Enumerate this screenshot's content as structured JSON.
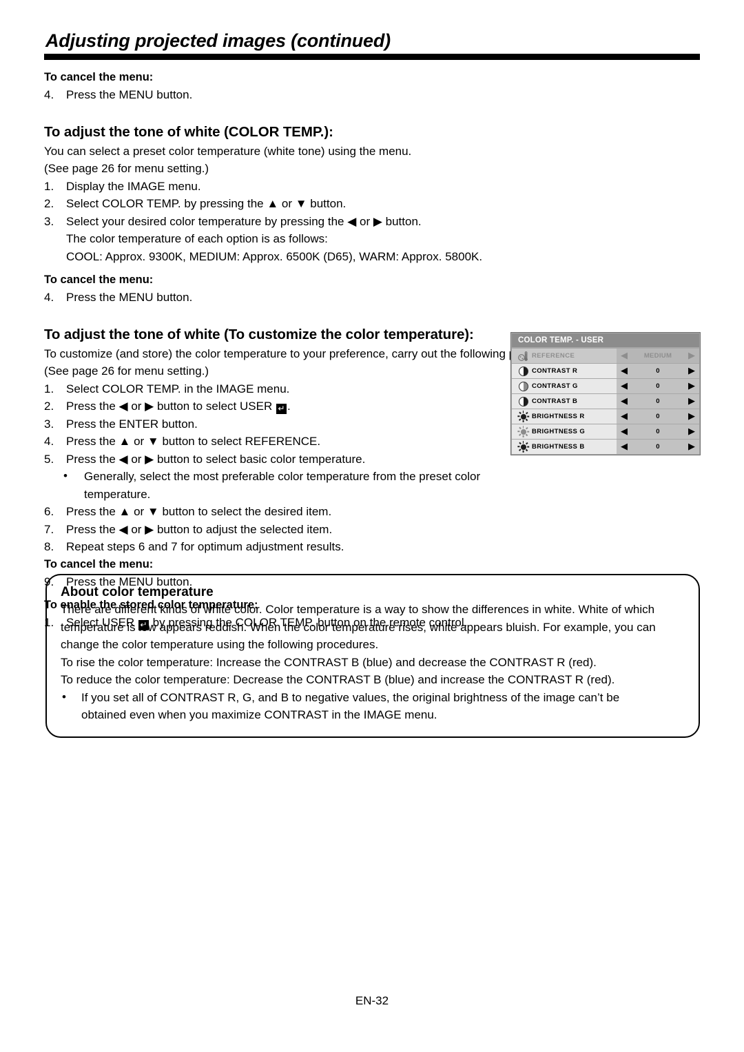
{
  "header": {
    "title": "Adjusting projected images (continued)"
  },
  "sections": {
    "cancel_heading_1": "To cancel the menu:",
    "cancel_step_1_num": "4.",
    "cancel_step_1_text": "Press the MENU button.",
    "colortemp_heading": "To adjust the tone of white (COLOR TEMP.):",
    "colortemp_intro_1": "You can select a preset color temperature (white tone) using the menu.",
    "colortemp_intro_2": "(See page 26 for menu setting.)",
    "colortemp_steps": [
      {
        "num": "1.",
        "lines": [
          "Display the IMAGE menu."
        ]
      },
      {
        "num": "2.",
        "lines": [
          "Select COLOR TEMP. by pressing the ▲ or ▼ button."
        ]
      },
      {
        "num": "3.",
        "lines": [
          "Select your desired color temperature by pressing the ◀ or ▶ button.",
          "The color temperature of each option is as follows:",
          "COOL: Approx. 9300K, MEDIUM: Approx. 6500K (D65), WARM: Approx. 5800K."
        ]
      }
    ],
    "cancel_heading_2": "To cancel the menu:",
    "cancel_step_2_num": "4.",
    "cancel_step_2_text": "Press the MENU button.",
    "customize_heading": "To adjust the tone of white (To customize the color temperature):",
    "customize_intro_1": "To customize (and store) the color temperature to your preference, carry out the following procedure.",
    "customize_intro_2": "(See page 26 for menu setting.)",
    "customize_steps": [
      {
        "num": "1.",
        "text": "Select COLOR TEMP. in the IMAGE menu."
      },
      {
        "num": "2.",
        "pre": "Press the ◀ or ▶ button to select USER ",
        "post": "."
      },
      {
        "num": "3.",
        "text": "Press the ENTER button."
      },
      {
        "num": "4.",
        "text": "Press the ▲ or ▼ button to select REFERENCE."
      },
      {
        "num": "5.",
        "text": "Press the ◀ or ▶ button to select basic color temperature."
      }
    ],
    "customize_bullet": [
      "Generally, select the most preferable color temperature from the preset color",
      "temperature."
    ],
    "customize_steps_2": [
      {
        "num": "6.",
        "text": "Press the ▲ or ▼ button to select the desired item."
      },
      {
        "num": "7.",
        "text": "Press the ◀ or ▶ button to adjust the selected item."
      },
      {
        "num": "8.",
        "text": "Repeat steps 6 and 7 for optimum adjustment results."
      }
    ],
    "cancel_heading_3": "To cancel the menu:",
    "cancel_step_3_num": "9.",
    "cancel_step_3_text": "Press the MENU button.",
    "enable_heading": "To enable the stored color temperature:",
    "enable_step_num": "1.",
    "enable_step_pre": "Select USER ",
    "enable_step_post": " by pressing the COLOR TEMP. button on the remote control."
  },
  "osd": {
    "title": "COLOR TEMP. - USER",
    "rows": [
      {
        "icon": "thermometer-icon",
        "label": "REFERENCE",
        "value": "MEDIUM",
        "disabled": true
      },
      {
        "icon": "contrast-icon",
        "label": "CONTRAST R",
        "value": "0",
        "disabled": false
      },
      {
        "icon": "contrast-icon",
        "label": "CONTRAST G",
        "value": "0",
        "disabled": false
      },
      {
        "icon": "contrast-icon",
        "label": "CONTRAST B",
        "value": "0",
        "disabled": false
      },
      {
        "icon": "brightness-icon",
        "label": "BRIGHTNESS R",
        "value": "0",
        "disabled": false
      },
      {
        "icon": "brightness-icon",
        "label": "BRIGHTNESS G",
        "value": "0",
        "disabled": false
      },
      {
        "icon": "brightness-icon",
        "label": "BRIGHTNESS B",
        "value": "0",
        "disabled": false
      }
    ],
    "left_arrow": "◀",
    "right_arrow": "▶"
  },
  "notebox": {
    "heading": "About color temperature",
    "paragraph_lines": [
      "There are different kinds of white color. Color temperature is a way to show the differences in white. White of which",
      "temperature is low appears reddish. When the color temperature rises, white appears bluish. For example, you can",
      "change the color temperature using the following procedures."
    ],
    "rise_line": "To rise the color temperature: Increase the CONTRAST B (blue) and decrease the CONTRAST R (red).",
    "reduce_line": "To reduce the color temperature: Decrease the CONTRAST B (blue) and increase the CONTRAST R (red).",
    "bullet_lines": [
      "If you set all of CONTRAST R, G, and B to negative values, the original brightness of the image can’t be",
      "obtained even when you maximize CONTRAST in the IMAGE menu."
    ]
  },
  "footer": {
    "page_label": "EN-32"
  },
  "colors": {
    "osd_header_bg": "#8c8c8c",
    "osd_label_bg": "#e9e9e9",
    "osd_value_bg": "#c2c2c2",
    "osd_disabled_text": "#8e8e8e",
    "rule": "#000000"
  }
}
